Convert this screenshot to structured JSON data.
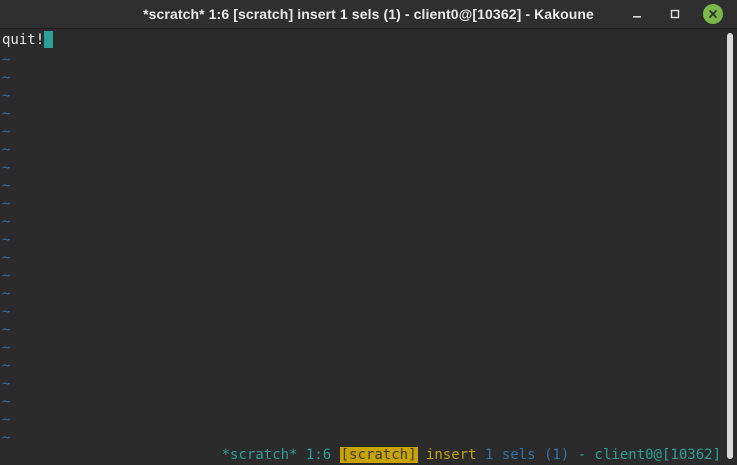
{
  "window": {
    "title": "*scratch* 1:6 [scratch] insert 1 sels (1) - client0@[10362] - Kakoune",
    "buttons": {
      "minimize": "minimize-icon",
      "maximize": "maximize-icon",
      "close": "close-icon"
    }
  },
  "editor": {
    "first_line": "quit!",
    "empty_line_marker": "~",
    "colors": {
      "background": "#2b2b2b",
      "text": "#e6e6e6",
      "tilde": "#2f72a8",
      "cursor": "#2aa198"
    }
  },
  "status": {
    "buffer": "*scratch*",
    "position": "1:6",
    "bufname": "[scratch]",
    "mode": "insert",
    "sels": "1 sels (1)",
    "client": "- client0@[10362]",
    "colors": {
      "cyan": "#2aa198",
      "yellow": "#c8a400",
      "blue": "#2f72a8"
    }
  }
}
